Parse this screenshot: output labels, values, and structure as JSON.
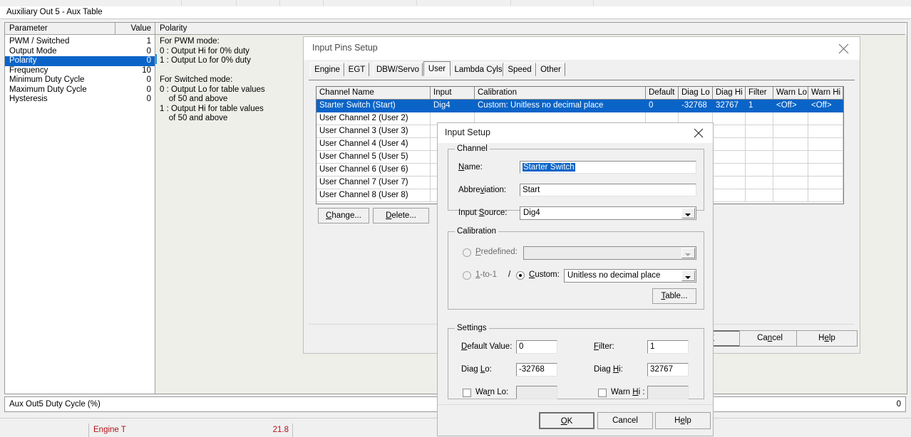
{
  "app": {
    "aux_panel_title": "Auxiliary Out 5 - Aux Table",
    "status_label": "Aux Out5 Duty Cycle (%)",
    "status_value": "0"
  },
  "param_grid": {
    "headers": {
      "parameter": "Parameter",
      "value": "Value",
      "description": "Polarity"
    },
    "rows": [
      {
        "name": "PWM / Switched",
        "value": "1",
        "selected": false
      },
      {
        "name": "Output Mode",
        "value": "0",
        "selected": false
      },
      {
        "name": "Polarity",
        "value": "0",
        "selected": true
      },
      {
        "name": "Frequency",
        "value": "10",
        "selected": false
      },
      {
        "name": "Minimum Duty Cycle",
        "value": "0",
        "selected": false
      },
      {
        "name": "Maximum Duty Cycle",
        "value": "0",
        "selected": false
      },
      {
        "name": "Hysteresis",
        "value": "0",
        "selected": false
      }
    ],
    "description_lines": [
      "For PWM mode:",
      "0 : Output Hi for 0% duty",
      "1 : Output Lo for 0% duty",
      "",
      "For Switched mode:",
      "0 : Output Lo for table values",
      "    of 50 and above",
      "1 : Output Hi for table values",
      "    of 50 and above"
    ]
  },
  "bottom_gauges": [
    {
      "label": "Engine T",
      "value": "21.8"
    }
  ],
  "pins_dialog": {
    "title": "Input Pins Setup",
    "close_icon": "close-icon",
    "tabs": [
      {
        "label": "Engine",
        "active": false
      },
      {
        "label": "EGT",
        "active": false
      },
      {
        "label": "DBW/Servo",
        "active": false
      },
      {
        "label": "User",
        "active": true
      },
      {
        "label": "Lambda Cyls",
        "active": false
      },
      {
        "label": "Speed",
        "active": false
      },
      {
        "label": "Other",
        "active": false
      }
    ],
    "grid": {
      "columns": [
        "Channel Name",
        "Input",
        "Calibration",
        "Default",
        "Diag Lo",
        "Diag Hi",
        "Filter",
        "Warn Lo",
        "Warn Hi"
      ],
      "rows": [
        {
          "selected": true,
          "cells": [
            "Starter Switch  (Start)",
            "Dig4",
            "Custom: Unitless no decimal place",
            "0",
            "-32768",
            "32767",
            "1",
            "<Off>",
            "<Off>"
          ]
        },
        {
          "selected": false,
          "cells": [
            "User Channel 2  (User 2)",
            "",
            "",
            "",
            "",
            "",
            "",
            "",
            ""
          ]
        },
        {
          "selected": false,
          "cells": [
            "User Channel 3  (User 3)",
            "",
            "",
            "",
            "",
            "",
            "",
            "",
            ""
          ]
        },
        {
          "selected": false,
          "cells": [
            "User Channel 4  (User 4)",
            "",
            "",
            "",
            "",
            "",
            "",
            "",
            ""
          ]
        },
        {
          "selected": false,
          "cells": [
            "User Channel 5  (User 5)",
            "",
            "",
            "",
            "",
            "",
            "",
            "",
            ""
          ]
        },
        {
          "selected": false,
          "cells": [
            "User Channel 6  (User 6)",
            "",
            "",
            "",
            "",
            "",
            "",
            "",
            ""
          ]
        },
        {
          "selected": false,
          "cells": [
            "User Channel 7  (User 7)",
            "",
            "",
            "",
            "",
            "",
            "",
            "",
            ""
          ]
        },
        {
          "selected": false,
          "cells": [
            "User Channel 8  (User 8)",
            "",
            "",
            "",
            "",
            "",
            "",
            "",
            ""
          ]
        }
      ]
    },
    "buttons": {
      "change": "Change...",
      "delete": "Delete...",
      "ok": "OK",
      "cancel": "Cancel",
      "help": "Help"
    }
  },
  "setup_dialog": {
    "title": "Input Setup",
    "close_icon": "close-icon",
    "channel_group": {
      "legend": "Channel",
      "name_label": "Name:",
      "name_value": "Starter Switch",
      "name_selected": true,
      "abbrev_label": "Abbreviation:",
      "abbrev_value": "Start",
      "source_label": "Input Source:",
      "source_value": "Dig4"
    },
    "calibration_group": {
      "legend": "Calibration",
      "predefined_label": "Predefined:",
      "predefined_selected": false,
      "predefined_value": "",
      "one_to_one_label": "1-to-1",
      "one_to_one_selected": false,
      "slash": "/",
      "custom_label": "Custom:",
      "custom_selected": true,
      "custom_value": "Unitless no decimal place",
      "table_button": "Table..."
    },
    "settings_group": {
      "legend": "Settings",
      "default_value_label": "Default Value:",
      "default_value": "0",
      "filter_label": "Filter:",
      "filter_value": "1",
      "diag_lo_label": "Diag Lo:",
      "diag_lo_value": "-32768",
      "diag_hi_label": "Diag Hi:",
      "diag_hi_value": "32767",
      "warn_lo_label": "Warn Lo:",
      "warn_lo_value": "",
      "warn_lo_checked": false,
      "warn_hi_label": "Warn Hi :",
      "warn_hi_value": "",
      "warn_hi_checked": false
    },
    "buttons": {
      "ok": "OK",
      "cancel": "Cancel",
      "help": "Help"
    }
  },
  "colors": {
    "selection_blue": "#0a64c8",
    "gauge_red": "#b5121b",
    "dialog_face": "#f0f0f0"
  }
}
